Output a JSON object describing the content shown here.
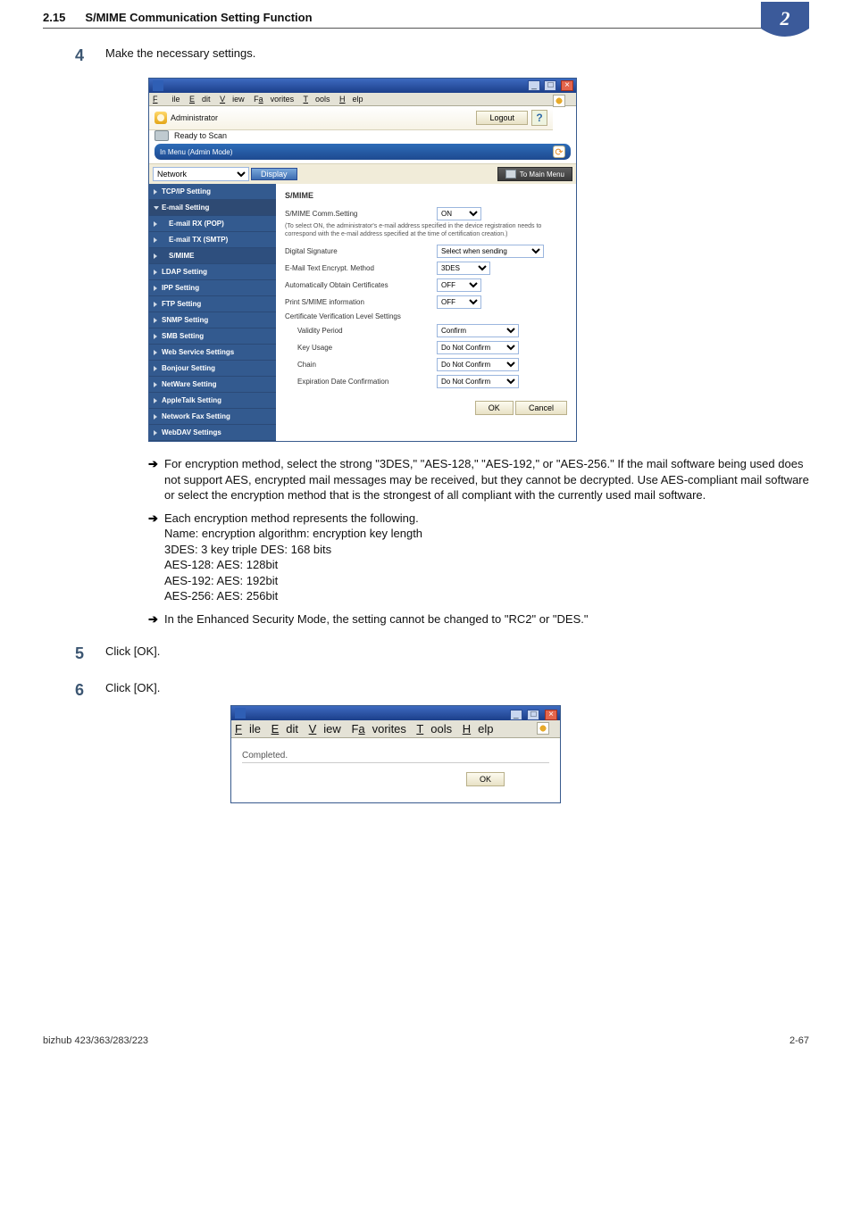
{
  "doc_header": {
    "section_number": "2.15",
    "section_title": "S/MIME Communication Setting Function",
    "chapter_badge": "2"
  },
  "steps": {
    "s4": {
      "num": "4",
      "text": "Make the necessary settings."
    },
    "s5": {
      "num": "5",
      "text": "Click [OK]."
    },
    "s6": {
      "num": "6",
      "text": "Click [OK]."
    }
  },
  "win_menu": {
    "file": "File",
    "edit": "Edit",
    "view": "View",
    "fav": "Favorites",
    "tools": "Tools",
    "help": "Help"
  },
  "admin_bar": {
    "administrator": "Administrator",
    "logout": "Logout",
    "help": "?"
  },
  "status": {
    "ready": "Ready to Scan",
    "in_menu": "In Menu (Admin Mode)"
  },
  "toolbar": {
    "dropdown_value": "Network",
    "display": "Display",
    "to_main": "To Main Menu"
  },
  "sidebar": {
    "items": [
      {
        "label": "TCP/IP Setting"
      },
      {
        "label": "E-mail Setting",
        "open": true
      },
      {
        "label": "E-mail RX (POP)",
        "sub": true
      },
      {
        "label": "E-mail TX (SMTP)",
        "sub": true
      },
      {
        "label": "S/MIME",
        "sub": true,
        "sel": true
      },
      {
        "label": "LDAP Setting"
      },
      {
        "label": "IPP Setting"
      },
      {
        "label": "FTP Setting"
      },
      {
        "label": "SNMP Setting"
      },
      {
        "label": "SMB Setting"
      },
      {
        "label": "Web Service Settings"
      },
      {
        "label": "Bonjour Setting"
      },
      {
        "label": "NetWare Setting"
      },
      {
        "label": "AppleTalk Setting"
      },
      {
        "label": "Network Fax Setting"
      },
      {
        "label": "WebDAV Settings"
      }
    ]
  },
  "form": {
    "heading": "S/MIME",
    "rows": {
      "comm": {
        "label": "S/MIME Comm.Setting",
        "value": "ON"
      },
      "note": "(To select ON, the administrator's e-mail address specified in the device registration needs to correspond with the e-mail address specified at the time of certification creation.)",
      "sig": {
        "label": "Digital Signature",
        "value": "Select when sending"
      },
      "enc": {
        "label": "E-Mail Text Encrypt. Method",
        "value": "3DES"
      },
      "auto": {
        "label": "Automatically Obtain Certificates",
        "value": "OFF"
      },
      "print": {
        "label": "Print S/MIME information",
        "value": "OFF"
      },
      "cvls": {
        "label": "Certificate Verification Level Settings"
      },
      "vp": {
        "label": "Validity Period",
        "value": "Confirm"
      },
      "ku": {
        "label": "Key Usage",
        "value": "Do Not Confirm"
      },
      "chain": {
        "label": "Chain",
        "value": "Do Not Confirm"
      },
      "exp": {
        "label": "Expiration Date Confirmation",
        "value": "Do Not Confirm"
      }
    },
    "ok": "OK",
    "cancel": "Cancel"
  },
  "bullets": {
    "b1": "For encryption method, select the strong \"3DES,\" \"AES-128,\" \"AES-192,\" or \"AES-256.\" If the mail software being used does not support AES, encrypted mail messages may be received, but they cannot be decrypted. Use AES-compliant mail software or select the encryption method that is the strongest of all compliant with the currently used mail software.",
    "b2_lead": "Each encryption method represents the following.",
    "b2_lines": [
      "Name: encryption algorithm: encryption key length",
      "3DES: 3 key triple DES: 168 bits",
      "AES-128: AES: 128bit",
      "AES-192: AES: 192bit",
      "AES-256: AES: 256bit"
    ],
    "b3": "In the Enhanced Security Mode, the setting cannot be changed to \"RC2\" or \"DES.\""
  },
  "win2": {
    "completed": "Completed.",
    "ok": "OK"
  },
  "footer": {
    "left": "bizhub 423/363/283/223",
    "right": "2-67"
  }
}
